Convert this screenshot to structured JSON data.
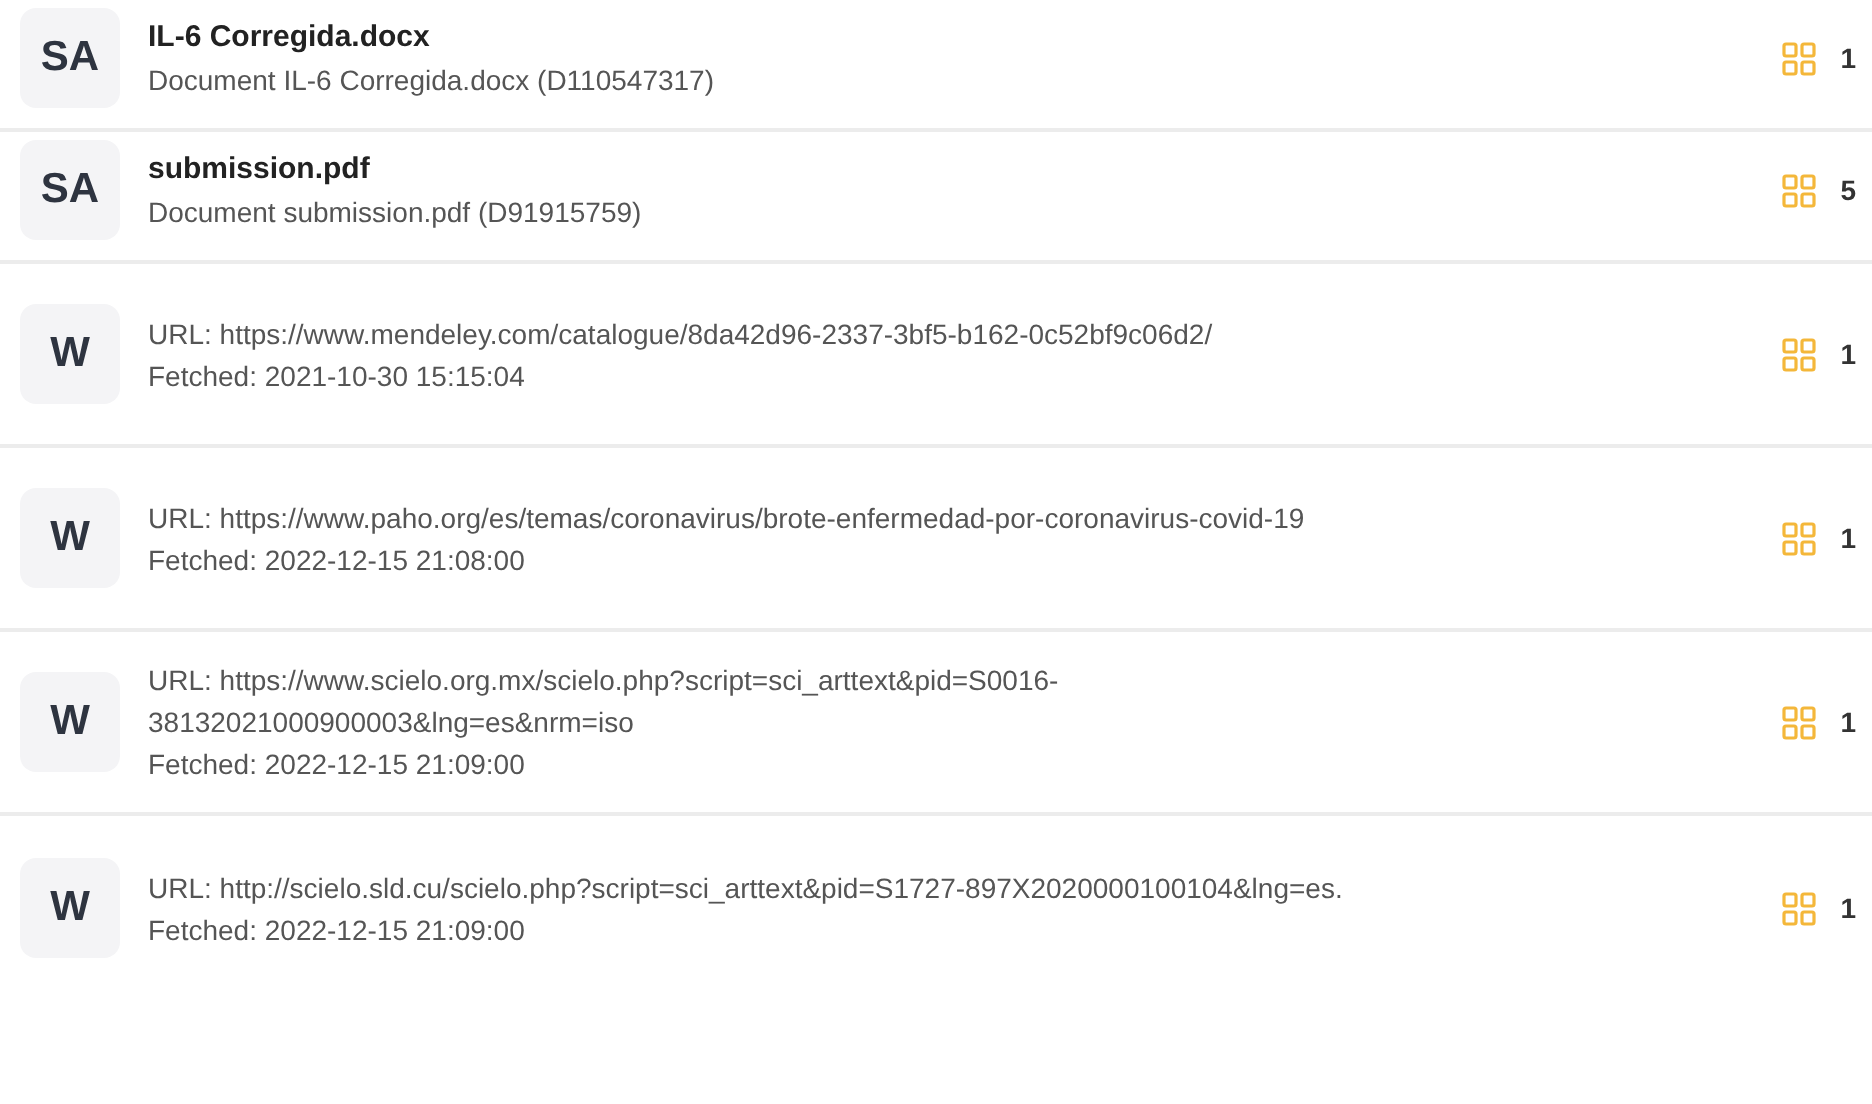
{
  "sources": [
    {
      "kind": "document",
      "badge": "SA",
      "title": "IL-6 Corregida.docx",
      "lines": [
        "Document IL-6 Corregida.docx (D110547317)"
      ],
      "count": "1"
    },
    {
      "kind": "document",
      "badge": "SA",
      "title": "submission.pdf",
      "lines": [
        "Document submission.pdf (D91915759)"
      ],
      "count": "5"
    },
    {
      "kind": "web",
      "badge": "W",
      "lines": [
        "URL: https://www.mendeley.com/catalogue/8da42d96-2337-3bf5-b162-0c52bf9c06d2/",
        "Fetched: 2021-10-30 15:15:04"
      ],
      "count": "1"
    },
    {
      "kind": "web",
      "badge": "W",
      "lines": [
        "URL: https://www.paho.org/es/temas/coronavirus/brote-enfermedad-por-coronavirus-covid-19",
        "Fetched: 2022-12-15 21:08:00"
      ],
      "count": "1"
    },
    {
      "kind": "web",
      "badge": "W",
      "lines": [
        "URL: https://www.scielo.org.mx/scielo.php?script=sci_arttext&pid=S0016-",
        "38132021000900003&lng=es&nrm=iso",
        "Fetched: 2022-12-15 21:09:00"
      ],
      "count": "1"
    },
    {
      "kind": "web",
      "badge": "W",
      "lines": [
        "URL: http://scielo.sld.cu/scielo.php?script=sci_arttext&pid=S1727-897X2020000100104&lng=es.",
        "Fetched: 2022-12-15 21:09:00"
      ],
      "count": "1"
    }
  ]
}
